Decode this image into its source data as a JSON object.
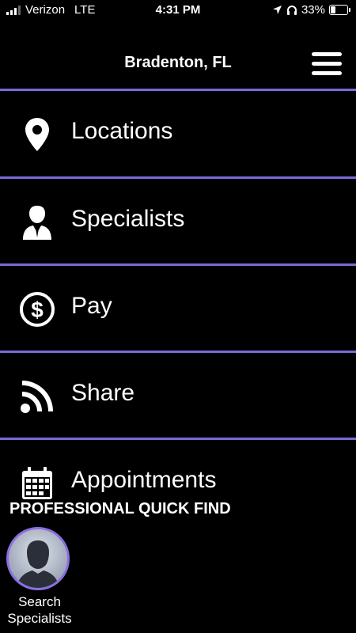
{
  "status_bar": {
    "carrier": "Verizon",
    "network": "LTE",
    "time": "4:31 PM",
    "battery": "33%",
    "battery_level": 0.33
  },
  "header": {
    "title": "Bradenton, FL",
    "menu_icon": "hamburger-menu-icon"
  },
  "nav": {
    "items": [
      {
        "label": "Locations",
        "icon": "map-pin-icon"
      },
      {
        "label": "Specialists",
        "icon": "person-icon"
      },
      {
        "label": "Pay",
        "icon": "dollar-circle-icon"
      },
      {
        "label": "Share",
        "icon": "rss-icon"
      },
      {
        "label": "Appointments",
        "icon": "calendar-icon"
      }
    ]
  },
  "quick_find": {
    "title": "PROFESSIONAL QUICK FIND",
    "search_label": "Search Specialists"
  },
  "colors": {
    "background": "#000000",
    "divider": "#7b68d9",
    "avatar_ring": "#8a6fe0",
    "text": "#ffffff"
  }
}
